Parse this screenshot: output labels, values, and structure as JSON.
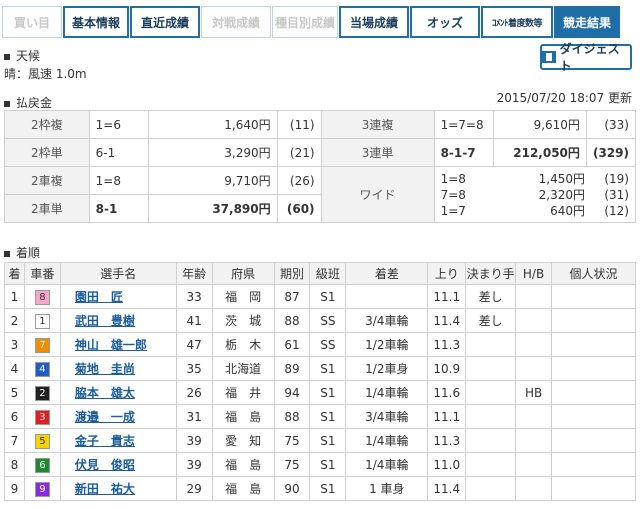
{
  "tabs": [
    {
      "label": "買い目",
      "state": "disabled",
      "width": 60
    },
    {
      "label": "基本情報",
      "state": "on",
      "width": 66
    },
    {
      "label": "直近成績",
      "state": "on",
      "width": 70
    },
    {
      "label": "対戦成績",
      "state": "disabled",
      "width": 70
    },
    {
      "label": "種目別成績",
      "state": "disabled",
      "width": 66
    },
    {
      "label": "当場成績",
      "state": "on",
      "width": 70
    },
    {
      "label": "オッズ",
      "state": "on",
      "width": 70
    },
    {
      "label": "ｺﾒﾝﾄ着度数等",
      "state": "on-small",
      "width": 72
    },
    {
      "label": "競走結果",
      "state": "active",
      "width": 66
    }
  ],
  "weather": {
    "heading": "天候",
    "text": "晴：風速 1.0m"
  },
  "digest_label": "ダイジェスト",
  "payout": {
    "heading": "払戻金",
    "updated": "2015/07/20 18:07 更新",
    "rows": [
      {
        "l_label": "2枠複",
        "l_combo": "1=6",
        "l_amt": "1,640円",
        "l_pop": "(11)",
        "r_label": "3連複",
        "r_combo": "1=7=8",
        "r_amt": "9,610円",
        "r_pop": "(33)"
      },
      {
        "l_label": "2枠単",
        "l_combo": "6-1",
        "l_amt": "3,290円",
        "l_pop": "(21)",
        "r_label": "3連単",
        "r_combo": "8-1-7",
        "r_amt": "212,050円",
        "r_pop": "(329)"
      },
      {
        "l_label": "2車複",
        "l_combo": "1=8",
        "l_amt": "9,710円",
        "l_pop": "(26)"
      },
      {
        "l_label": "2車単",
        "l_combo": "8-1",
        "l_amt": "37,890円",
        "l_pop": "(60)"
      }
    ],
    "wide": {
      "label": "ワイド",
      "lines": [
        {
          "combo": "1=8",
          "amt": "1,450円",
          "pop": "(19)"
        },
        {
          "combo": "7=8",
          "amt": "2,320円",
          "pop": "(31)"
        },
        {
          "combo": "1=7",
          "amt": "640円",
          "pop": "(12)"
        }
      ]
    }
  },
  "results": {
    "heading": "着順",
    "headers": [
      "着",
      "車番",
      "選手名",
      "年齢",
      "府県",
      "期別",
      "級班",
      "着差",
      "上り",
      "決まり手",
      "H/B",
      "個人状況"
    ],
    "rows": [
      {
        "rank": "1",
        "num": "8",
        "name": "園田　匠",
        "age": "33",
        "pref": "福　岡",
        "term": "87",
        "cls": "S1",
        "diff": "",
        "agari": "11.1",
        "kimari": "差し",
        "hb": "",
        "status": ""
      },
      {
        "rank": "2",
        "num": "1",
        "name": "武田　豊樹",
        "age": "41",
        "pref": "茨　城",
        "term": "88",
        "cls": "SS",
        "diff": "3/4車輪",
        "agari": "11.4",
        "kimari": "差し",
        "hb": "",
        "status": ""
      },
      {
        "rank": "3",
        "num": "7",
        "name": "神山　雄一郎",
        "age": "47",
        "pref": "栃　木",
        "term": "61",
        "cls": "SS",
        "diff": "1/2車輪",
        "agari": "11.3",
        "kimari": "",
        "hb": "",
        "status": ""
      },
      {
        "rank": "4",
        "num": "4",
        "name": "菊地　圭尚",
        "age": "35",
        "pref": "北海道",
        "term": "89",
        "cls": "S1",
        "diff": "1/2車身",
        "agari": "10.9",
        "kimari": "",
        "hb": "",
        "status": ""
      },
      {
        "rank": "5",
        "num": "2",
        "name": "脇本　雄太",
        "age": "26",
        "pref": "福　井",
        "term": "94",
        "cls": "S1",
        "diff": "1/4車輪",
        "agari": "11.6",
        "kimari": "",
        "hb": "HB",
        "status": ""
      },
      {
        "rank": "6",
        "num": "3",
        "name": "渡邉　一成",
        "age": "31",
        "pref": "福　島",
        "term": "88",
        "cls": "S1",
        "diff": "3/4車輪",
        "agari": "11.1",
        "kimari": "",
        "hb": "",
        "status": ""
      },
      {
        "rank": "7",
        "num": "5",
        "name": "金子　貴志",
        "age": "39",
        "pref": "愛　知",
        "term": "75",
        "cls": "S1",
        "diff": "1/4車輪",
        "agari": "11.3",
        "kimari": "",
        "hb": "",
        "status": ""
      },
      {
        "rank": "8",
        "num": "6",
        "name": "伏見　俊昭",
        "age": "39",
        "pref": "福　島",
        "term": "75",
        "cls": "S1",
        "diff": "1/4車輪",
        "agari": "11.0",
        "kimari": "",
        "hb": "",
        "status": ""
      },
      {
        "rank": "9",
        "num": "9",
        "name": "新田　祐大",
        "age": "29",
        "pref": "福　島",
        "term": "90",
        "cls": "S1",
        "diff": "1 車身",
        "agari": "11.4",
        "kimari": "",
        "hb": "",
        "status": ""
      }
    ]
  },
  "bike_colors": {
    "1": {
      "bg": "#ffffff",
      "fg": "#333333"
    },
    "2": {
      "bg": "#222222",
      "fg": "#ffffff"
    },
    "3": {
      "bg": "#e02020",
      "fg": "#ffffff"
    },
    "4": {
      "bg": "#1e5fbf",
      "fg": "#ffffff"
    },
    "5": {
      "bg": "#f5d200",
      "fg": "#333333"
    },
    "6": {
      "bg": "#1a8a2a",
      "fg": "#ffffff"
    },
    "7": {
      "bg": "#f08c00",
      "fg": "#ffffff"
    },
    "8": {
      "bg": "#f7a6c8",
      "fg": "#333333"
    },
    "9": {
      "bg": "#8a2be2",
      "fg": "#ffffff"
    }
  }
}
